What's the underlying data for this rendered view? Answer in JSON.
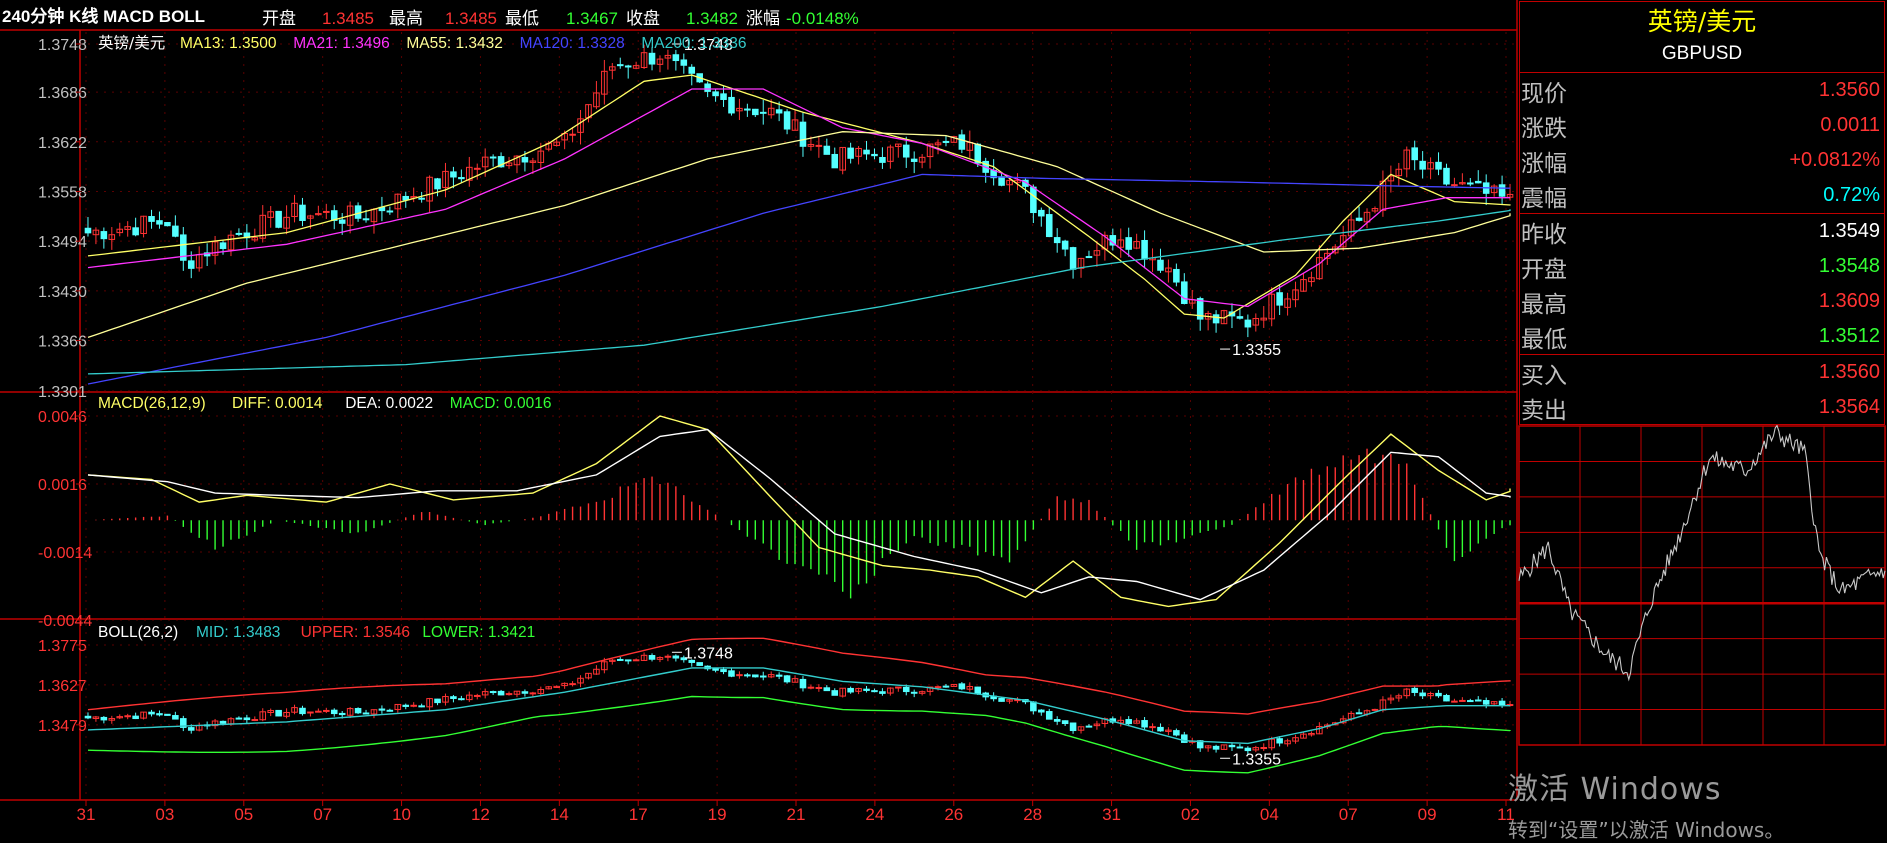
{
  "header": {
    "title": "240分钟 K线 MACD BOLL",
    "open_label": "开盘",
    "open_value": "1.3485",
    "high_label": "最高",
    "high_value": "1.3485",
    "low_label": "最低",
    "low_value": "1.3467",
    "close_label": "收盘",
    "close_value": "1.3482",
    "change_label": "涨幅",
    "change_value": "-0.0148%"
  },
  "info_panel": {
    "name": "英镑/美元",
    "code": "GBPUSD",
    "rows": [
      {
        "label": "现价",
        "value": "1.3560",
        "color": "#ff3333"
      },
      {
        "label": "涨跌",
        "value": "0.0011",
        "color": "#ff3333"
      },
      {
        "label": "涨幅",
        "value": "+0.0812%",
        "color": "#ff3333"
      },
      {
        "label": "震幅",
        "value": "0.72%",
        "color": "#00ffff"
      },
      {
        "label": "昨收",
        "value": "1.3549",
        "color": "#ffffff"
      },
      {
        "label": "开盘",
        "value": "1.3548",
        "color": "#33ff33"
      },
      {
        "label": "最高",
        "value": "1.3609",
        "color": "#ff3333"
      },
      {
        "label": "最低",
        "value": "1.3512",
        "color": "#33ff33"
      },
      {
        "label": "买入",
        "value": "1.3560",
        "color": "#ff3333"
      },
      {
        "label": "卖出",
        "value": "1.3564",
        "color": "#ff3333"
      }
    ]
  },
  "watermark": {
    "line1": "激活 Windows",
    "line2": "转到“设置”以激活 Windows。"
  },
  "chart_data": [
    {
      "type": "candlestick",
      "panel": "price",
      "symbol_label": "英镑/美元",
      "legend": [
        {
          "text": "MA13: 1.3500",
          "color": "#ffff66"
        },
        {
          "text": "MA21: 1.3496",
          "color": "#ff33ff"
        },
        {
          "text": "MA55: 1.3432",
          "color": "#ffff99"
        },
        {
          "text": "MA120: 1.3328",
          "color": "#4444ff"
        },
        {
          "text": "MA200: 1.3336",
          "color": "#33cccc"
        }
      ],
      "ylim": [
        1.3301,
        1.3748
      ],
      "y_ticks": [
        "1.3748",
        "1.3686",
        "1.3622",
        "1.3558",
        "1.3494",
        "1.3430",
        "1.3366",
        "1.3301"
      ],
      "bars": 180,
      "x_ticks": [
        "31",
        "03",
        "05",
        "07",
        "10",
        "12",
        "14",
        "17",
        "19",
        "21",
        "24",
        "26",
        "28",
        "31",
        "02",
        "04",
        "07",
        "09",
        "11"
      ],
      "close_anchors": [
        [
          0,
          1.3505
        ],
        [
          10,
          1.352
        ],
        [
          12,
          1.3465
        ],
        [
          18,
          1.35
        ],
        [
          26,
          1.353
        ],
        [
          34,
          1.3525
        ],
        [
          42,
          1.356
        ],
        [
          50,
          1.3595
        ],
        [
          60,
          1.362
        ],
        [
          66,
          1.372
        ],
        [
          72,
          1.3735
        ],
        [
          78,
          1.368
        ],
        [
          86,
          1.366
        ],
        [
          94,
          1.36
        ],
        [
          104,
          1.361
        ],
        [
          110,
          1.362
        ],
        [
          118,
          1.3555
        ],
        [
          124,
          1.347
        ],
        [
          130,
          1.3505
        ],
        [
          136,
          1.346
        ],
        [
          140,
          1.3395
        ],
        [
          146,
          1.339
        ],
        [
          152,
          1.344
        ],
        [
          160,
          1.352
        ],
        [
          166,
          1.36
        ],
        [
          171,
          1.357
        ],
        [
          179,
          1.3545
        ]
      ],
      "ma_series": {
        "MA13": [
          [
            0,
            1.3475
          ],
          [
            25,
            1.3505
          ],
          [
            45,
            1.356
          ],
          [
            58,
            1.362
          ],
          [
            70,
            1.37
          ],
          [
            76,
            1.3708
          ],
          [
            90,
            1.366
          ],
          [
            105,
            1.362
          ],
          [
            114,
            1.359
          ],
          [
            126,
            1.35
          ],
          [
            133,
            1.3445
          ],
          [
            138,
            1.34
          ],
          [
            143,
            1.3395
          ],
          [
            152,
            1.345
          ],
          [
            158,
            1.352
          ],
          [
            164,
            1.358
          ],
          [
            172,
            1.3545
          ],
          [
            180,
            1.354
          ]
        ],
        "MA21": [
          [
            0,
            1.346
          ],
          [
            25,
            1.349
          ],
          [
            45,
            1.3535
          ],
          [
            60,
            1.36
          ],
          [
            76,
            1.369
          ],
          [
            85,
            1.369
          ],
          [
            95,
            1.364
          ],
          [
            105,
            1.362
          ],
          [
            118,
            1.357
          ],
          [
            128,
            1.35
          ],
          [
            138,
            1.342
          ],
          [
            146,
            1.341
          ],
          [
            155,
            1.3465
          ],
          [
            163,
            1.3535
          ],
          [
            171,
            1.355
          ],
          [
            180,
            1.355
          ]
        ],
        "MA55": [
          [
            0,
            1.337
          ],
          [
            20,
            1.344
          ],
          [
            40,
            1.349
          ],
          [
            60,
            1.354
          ],
          [
            78,
            1.36
          ],
          [
            95,
            1.3635
          ],
          [
            108,
            1.363
          ],
          [
            122,
            1.359
          ],
          [
            135,
            1.353
          ],
          [
            148,
            1.348
          ],
          [
            160,
            1.3485
          ],
          [
            172,
            1.3505
          ],
          [
            180,
            1.353
          ]
        ],
        "MA120": [
          [
            0,
            1.331
          ],
          [
            30,
            1.337
          ],
          [
            60,
            1.345
          ],
          [
            85,
            1.353
          ],
          [
            105,
            1.358
          ],
          [
            120,
            1.3575
          ],
          [
            145,
            1.357
          ],
          [
            165,
            1.3565
          ],
          [
            180,
            1.3562
          ]
        ],
        "MA200": [
          [
            0,
            1.3323
          ],
          [
            40,
            1.3335
          ],
          [
            70,
            1.336
          ],
          [
            100,
            1.341
          ],
          [
            125,
            1.346
          ],
          [
            150,
            1.3495
          ],
          [
            170,
            1.352
          ],
          [
            180,
            1.3535
          ]
        ]
      },
      "annotations": [
        {
          "text": "1.3748",
          "bar": 73,
          "value": 1.3748
        },
        {
          "text": "1.3355",
          "bar": 142,
          "value": 1.3355
        }
      ]
    },
    {
      "type": "bar",
      "panel": "macd",
      "label": "MACD(26,12,9)",
      "legend": [
        {
          "text": "DIFF: 0.0014",
          "color": "#ffff66"
        },
        {
          "text": "DEA: 0.0022",
          "color": "#ffffff"
        },
        {
          "text": "MACD: 0.0016",
          "color": "#33ff33"
        }
      ],
      "ylim": [
        -0.0044,
        0.0046
      ],
      "y_ticks": [
        "0.0046",
        "0.0016",
        "-0.0014",
        "-0.0044"
      ],
      "diff": [
        [
          0,
          0.002
        ],
        [
          8,
          0.0018
        ],
        [
          14,
          0.0008
        ],
        [
          20,
          0.0011
        ],
        [
          30,
          0.0008
        ],
        [
          38,
          0.0016
        ],
        [
          46,
          0.0009
        ],
        [
          56,
          0.0012
        ],
        [
          64,
          0.0025
        ],
        [
          72,
          0.0046
        ],
        [
          78,
          0.004
        ],
        [
          86,
          0.001
        ],
        [
          92,
          -0.0012
        ],
        [
          100,
          -0.002
        ],
        [
          106,
          -0.0022
        ],
        [
          112,
          -0.0025
        ],
        [
          118,
          -0.0034
        ],
        [
          124,
          -0.0018
        ],
        [
          130,
          -0.0034
        ],
        [
          136,
          -0.0038
        ],
        [
          142,
          -0.0035
        ],
        [
          150,
          -0.001
        ],
        [
          158,
          0.0018
        ],
        [
          164,
          0.0038
        ],
        [
          170,
          0.0022
        ],
        [
          176,
          0.0009
        ],
        [
          180,
          0.0014
        ]
      ],
      "dea": [
        [
          0,
          0.002
        ],
        [
          10,
          0.0017
        ],
        [
          16,
          0.0012
        ],
        [
          24,
          0.0011
        ],
        [
          34,
          0.001
        ],
        [
          44,
          0.0013
        ],
        [
          54,
          0.0013
        ],
        [
          64,
          0.002
        ],
        [
          72,
          0.0037
        ],
        [
          78,
          0.004
        ],
        [
          86,
          0.0018
        ],
        [
          94,
          -0.0006
        ],
        [
          104,
          -0.0016
        ],
        [
          112,
          -0.0022
        ],
        [
          120,
          -0.0032
        ],
        [
          126,
          -0.0025
        ],
        [
          132,
          -0.0027
        ],
        [
          140,
          -0.0035
        ],
        [
          148,
          -0.0022
        ],
        [
          156,
          0.0002
        ],
        [
          164,
          0.003
        ],
        [
          170,
          0.0028
        ],
        [
          176,
          0.0012
        ],
        [
          180,
          0.001
        ]
      ],
      "hist": [
        [
          0,
          0.0
        ],
        [
          10,
          0.0002
        ],
        [
          16,
          -0.0012
        ],
        [
          24,
          0.0
        ],
        [
          34,
          -0.0006
        ],
        [
          42,
          0.0004
        ],
        [
          50,
          -0.0002
        ],
        [
          56,
          0.0001
        ],
        [
          64,
          0.0008
        ],
        [
          70,
          0.0018
        ],
        [
          74,
          0.0014
        ],
        [
          80,
          0.0
        ],
        [
          88,
          -0.0018
        ],
        [
          96,
          -0.003
        ],
        [
          104,
          -0.0008
        ],
        [
          110,
          -0.0012
        ],
        [
          116,
          -0.0018
        ],
        [
          122,
          0.001
        ],
        [
          126,
          0.0008
        ],
        [
          132,
          -0.0012
        ],
        [
          138,
          -0.0008
        ],
        [
          144,
          -0.0002
        ],
        [
          152,
          0.0018
        ],
        [
          160,
          0.003
        ],
        [
          166,
          0.0026
        ],
        [
          172,
          -0.002
        ],
        [
          178,
          -0.0004
        ],
        [
          180,
          0.0
        ]
      ]
    },
    {
      "type": "line",
      "panel": "boll",
      "label": "BOLL(26,2)",
      "legend": [
        {
          "text": "MID: 1.3483",
          "color": "#33cccc"
        },
        {
          "text": "UPPER: 1.3546",
          "color": "#ff3333"
        },
        {
          "text": "LOWER: 1.3421",
          "color": "#33ff33"
        }
      ],
      "ylim": [
        1.333,
        1.3775
      ],
      "y_ticks": [
        "1.3775",
        "1.3627",
        "1.3479"
      ],
      "annotations": [
        {
          "text": "1.3748",
          "bar": 73,
          "value": 1.3748
        },
        {
          "text": "1.3355",
          "bar": 142,
          "value": 1.3355
        }
      ]
    }
  ]
}
